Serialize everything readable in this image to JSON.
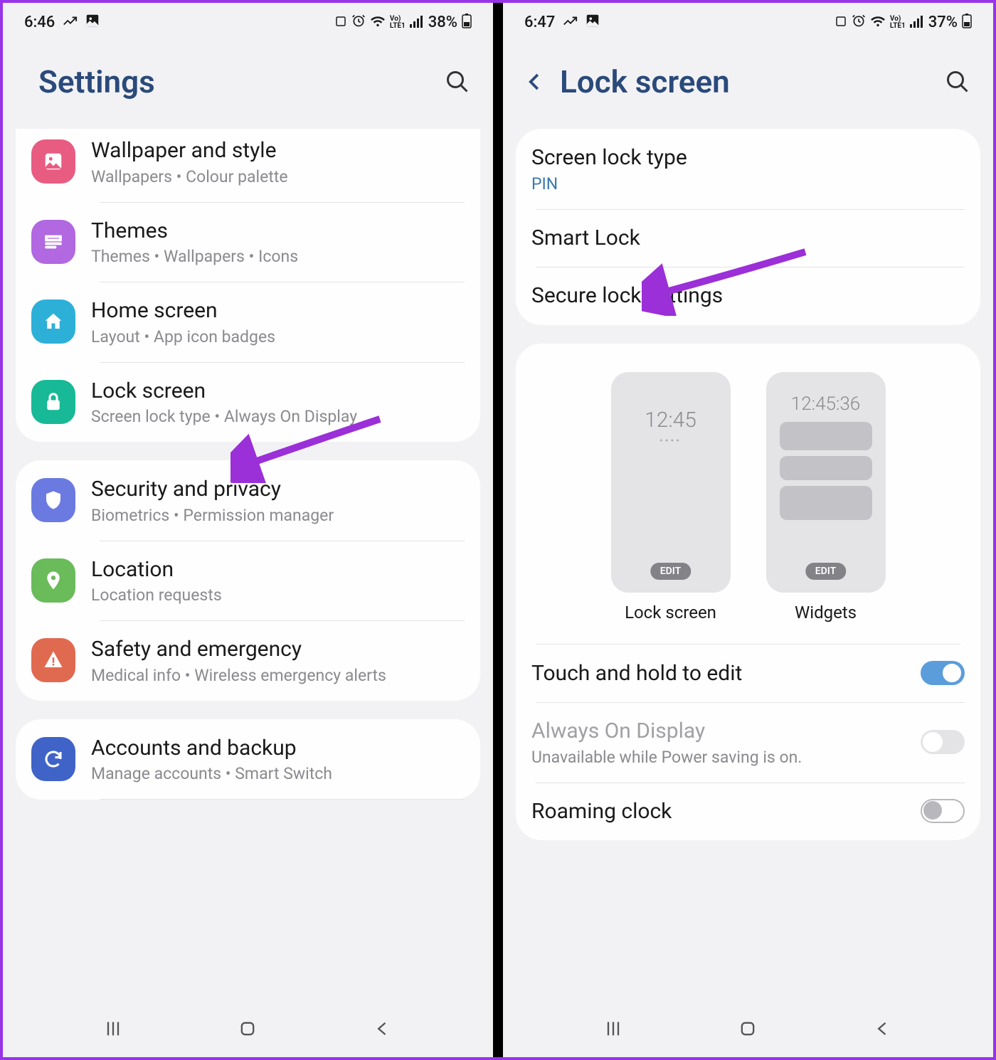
{
  "left": {
    "status": {
      "time": "6:46",
      "battery": "38%"
    },
    "header": {
      "title": "Settings"
    },
    "groups": [
      {
        "items": [
          {
            "icon": "wallpaper",
            "color": "#e85c82",
            "title": "Wallpaper and style",
            "sub": "Wallpapers  •  Colour palette"
          },
          {
            "icon": "themes",
            "color": "#b168e0",
            "title": "Themes",
            "sub": "Themes  •  Wallpapers  •  Icons"
          },
          {
            "icon": "home",
            "color": "#2db0d8",
            "title": "Home screen",
            "sub": "Layout  •  App icon badges"
          },
          {
            "icon": "lock",
            "color": "#17b996",
            "title": "Lock screen",
            "sub": "Screen lock type  •  Always On Display"
          }
        ]
      },
      {
        "items": [
          {
            "icon": "shield",
            "color": "#6b7ae0",
            "title": "Security and privacy",
            "sub": "Biometrics  •  Permission manager"
          },
          {
            "icon": "pin",
            "color": "#6abb5a",
            "title": "Location",
            "sub": "Location requests"
          },
          {
            "icon": "alert",
            "color": "#e06a50",
            "title": "Safety and emergency",
            "sub": "Medical info  •  Wireless emergency alerts"
          }
        ]
      },
      {
        "items": [
          {
            "icon": "sync",
            "color": "#3f63c7",
            "title": "Accounts and backup",
            "sub": "Manage accounts  •  Smart Switch"
          }
        ]
      }
    ]
  },
  "right": {
    "status": {
      "time": "6:47",
      "battery": "37%"
    },
    "header": {
      "title": "Lock screen"
    },
    "group1": [
      {
        "title": "Screen lock type",
        "sub": "PIN",
        "accent": true
      },
      {
        "title": "Smart Lock"
      },
      {
        "title": "Secure lock settings"
      }
    ],
    "preview": {
      "lock": {
        "time": "12:45",
        "label": "Lock screen",
        "edit": "EDIT"
      },
      "widgets": {
        "time": "12:45:36",
        "label": "Widgets",
        "edit": "EDIT"
      }
    },
    "group3": [
      {
        "title": "Touch and hold to edit",
        "toggle": "on"
      },
      {
        "title": "Always On Display",
        "sub": "Unavailable while Power saving is on.",
        "toggle": "off",
        "disabled": true
      },
      {
        "title": "Roaming clock",
        "toggle": "outline"
      }
    ]
  },
  "status_icons": {
    "volte": "VoLTE"
  }
}
